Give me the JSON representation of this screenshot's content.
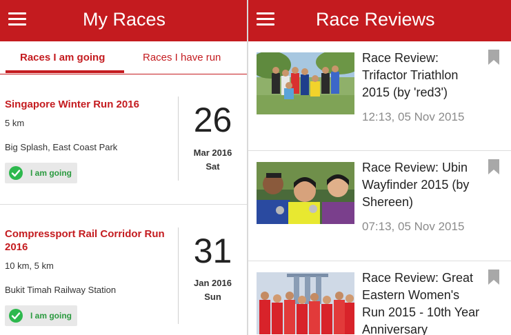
{
  "left_panel": {
    "title": "My Races",
    "tabs": [
      {
        "label": "Races I am going",
        "active": true
      },
      {
        "label": "Races I have run",
        "active": false
      }
    ],
    "races": [
      {
        "name": "Singapore Winter Run 2016",
        "distance": "5 km",
        "location": "Big Splash, East Coast Park",
        "status": "I am going",
        "day": "26",
        "month_year": "Mar 2016",
        "weekday": "Sat"
      },
      {
        "name": "Compressport Rail Corridor Run 2016",
        "distance": "10 km, 5 km",
        "location": "Bukit Timah Railway Station",
        "status": "I am going",
        "day": "31",
        "month_year": "Jan 2016",
        "weekday": "Sun"
      }
    ]
  },
  "right_panel": {
    "title": "Race Reviews",
    "reviews": [
      {
        "title": "Race Review: Trifactor Triathlon 2015 (by 'red3')",
        "time": "12:13, 05 Nov 2015"
      },
      {
        "title": "Race Review: Ubin Wayfinder 2015 (by Shereen)",
        "time": "07:13, 05 Nov 2015"
      },
      {
        "title": "Race Review: Great Eastern Women's Run 2015 - 10th Year Anniversary",
        "time": ""
      }
    ]
  },
  "colors": {
    "brand_red": "#c41b1f",
    "going_green": "#2db84d",
    "bookmark_gray": "#a8a8a8"
  },
  "icons": [
    "menu-icon",
    "check-circle-icon",
    "bookmark-icon"
  ]
}
